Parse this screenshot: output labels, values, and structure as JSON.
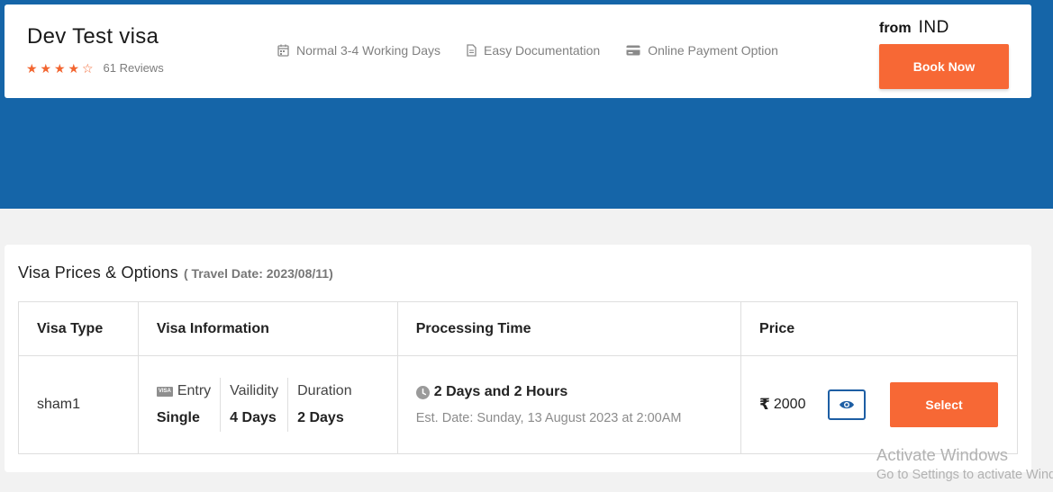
{
  "header": {
    "title": "Dev Test visa",
    "rating": 4,
    "rating_max": 5,
    "reviews": "61 Reviews",
    "features": [
      {
        "icon": "calendar-icon",
        "label": "Normal 3-4 Working Days"
      },
      {
        "icon": "document-icon",
        "label": "Easy Documentation"
      },
      {
        "icon": "credit-card-icon",
        "label": "Online Payment Option"
      }
    ],
    "from_label": "from",
    "from_currency": "IND",
    "book_label": "Book Now"
  },
  "options": {
    "title": "Visa Prices & Options",
    "travel_date": "( Travel Date: 2023/08/11)",
    "columns": [
      "Visa Type",
      "Visa Information",
      "Processing Time",
      "Price"
    ],
    "rows": [
      {
        "visa_type": "sham1",
        "info": [
          {
            "label": "Entry",
            "value": "Single"
          },
          {
            "label": "Vailidity",
            "value": "4 Days"
          },
          {
            "label": "Duration",
            "value": "2 Days"
          }
        ],
        "processing": "2 Days and 2 Hours",
        "est_date": "Est. Date: Sunday, 13 August 2023 at 2:00AM",
        "currency_symbol": "₹",
        "price": "2000",
        "select_label": "Select"
      }
    ]
  },
  "watermark": {
    "line1": "Activate Windows",
    "line2": "Go to Settings to activate Windows."
  },
  "colors": {
    "brand_blue": "#1565a8",
    "accent_orange": "#f76835",
    "star": "#f26530"
  }
}
